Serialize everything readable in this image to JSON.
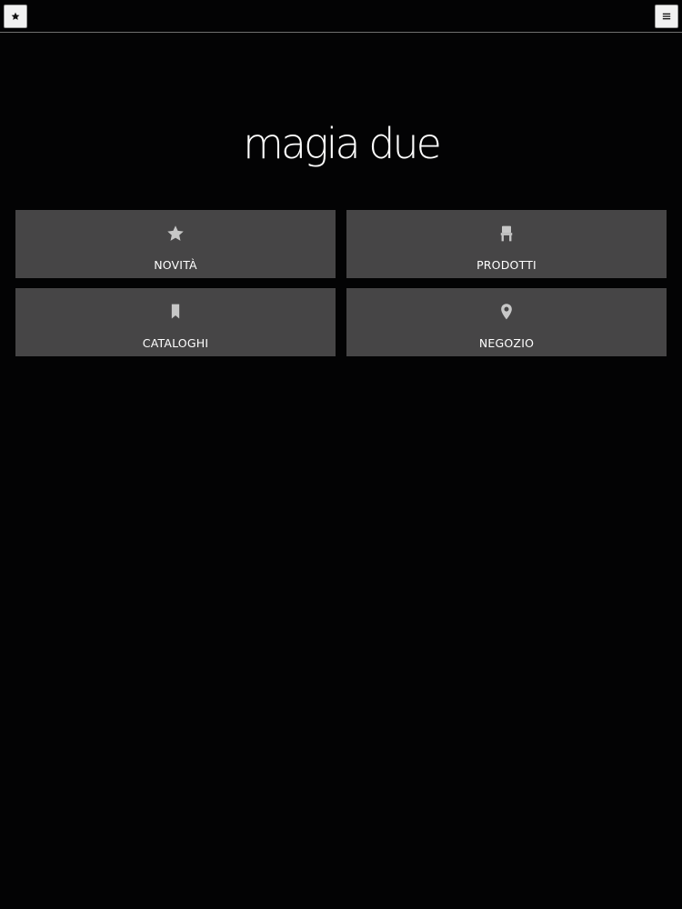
{
  "header": {
    "left_icon": "star-icon",
    "right_icon": "menu-icon"
  },
  "brand": {
    "logo_text": "magia due"
  },
  "tiles": [
    {
      "label": "NOVITÀ",
      "icon": "star-icon"
    },
    {
      "label": "PRODOTTI",
      "icon": "chair-icon"
    },
    {
      "label": "CATALOGHI",
      "icon": "bookmark-icon"
    },
    {
      "label": "NEGOZIO",
      "icon": "map-pin-icon"
    }
  ],
  "colors": {
    "background": "#030304",
    "tile": "#464546",
    "icon": "#c7c7c7",
    "text": "#ffffff"
  }
}
